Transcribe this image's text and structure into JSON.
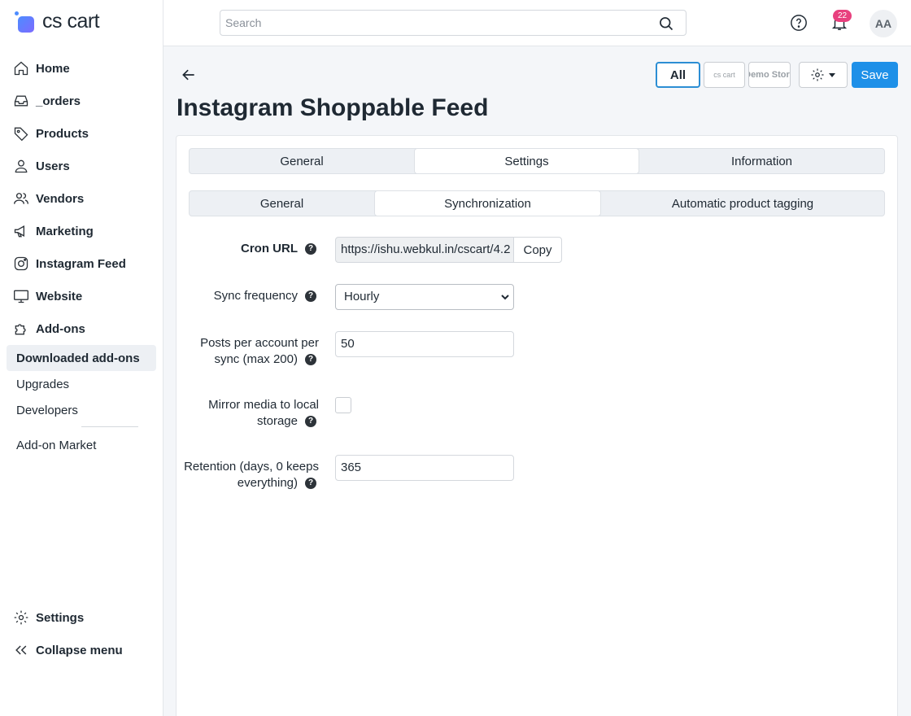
{
  "app": {
    "logo_text": "cs cart"
  },
  "sidebar": {
    "items": [
      {
        "label": "Home"
      },
      {
        "label": "_orders"
      },
      {
        "label": "Products"
      },
      {
        "label": "Users"
      },
      {
        "label": "Vendors"
      },
      {
        "label": "Marketing"
      },
      {
        "label": "Instagram Feed"
      },
      {
        "label": "Website"
      },
      {
        "label": "Add-ons"
      }
    ],
    "subitems": [
      {
        "label": "Downloaded add-ons"
      },
      {
        "label": "Upgrades"
      },
      {
        "label": "Developers"
      },
      {
        "label": "Add-on Market"
      }
    ],
    "bottom": [
      {
        "label": "Settings"
      },
      {
        "label": "Collapse menu"
      }
    ]
  },
  "topbar": {
    "search_placeholder": "Search",
    "notifications_count": "22",
    "avatar_initials": "AA"
  },
  "header": {
    "title": "Instagram Shoppable Feed",
    "store_all": "All",
    "store_1": "cs cart",
    "store_2": "Demo Store",
    "save_label": "Save"
  },
  "tabs": {
    "main": [
      {
        "label": "General"
      },
      {
        "label": "Settings"
      },
      {
        "label": "Information"
      }
    ],
    "sub": [
      {
        "label": "General"
      },
      {
        "label": "Synchronization"
      },
      {
        "label": "Automatic product tagging"
      }
    ]
  },
  "form": {
    "cron_url": {
      "label": "Cron URL",
      "value": "https://ishu.webkul.in/cscart/4.2",
      "copy_label": "Copy"
    },
    "sync_frequency": {
      "label": "Sync frequency",
      "value": "Hourly"
    },
    "posts_per_account": {
      "label_line1": "Posts per account per",
      "label_line2": "sync (max 200)",
      "value": "50"
    },
    "mirror_media": {
      "label_line1": "Mirror media to local",
      "label_line2": "storage",
      "checked": false
    },
    "retention": {
      "label_line1": "Retention (days, 0 keeps",
      "label_line2": "everything)",
      "value": "365"
    }
  },
  "colors": {
    "accent": "#1e90e8",
    "badge": "#e8407e",
    "logo": "#4d8cff"
  }
}
